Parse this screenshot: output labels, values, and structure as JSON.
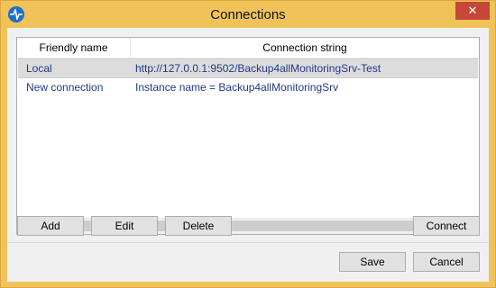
{
  "window": {
    "title": "Connections",
    "close_symbol": "✕",
    "app_icon": "pulse-icon",
    "colors": {
      "frame": "#f0c35a",
      "close": "#c7463a",
      "selection": "#dcdcdc",
      "link_text": "#1f3a8a"
    }
  },
  "list": {
    "columns": [
      "Friendly name",
      "Connection string"
    ],
    "rows": [
      {
        "name": "Local",
        "connection": "http://127.0.0.1:9502/Backup4allMonitoringSrv-Test",
        "selected": true
      },
      {
        "name": "New connection",
        "connection": "Instance name = Backup4allMonitoringSrv",
        "selected": false
      }
    ],
    "scroll_left": "‹",
    "scroll_right": "›"
  },
  "buttons": {
    "add": "Add",
    "edit": "Edit",
    "delete": "Delete",
    "connect": "Connect",
    "save": "Save",
    "cancel": "Cancel"
  }
}
